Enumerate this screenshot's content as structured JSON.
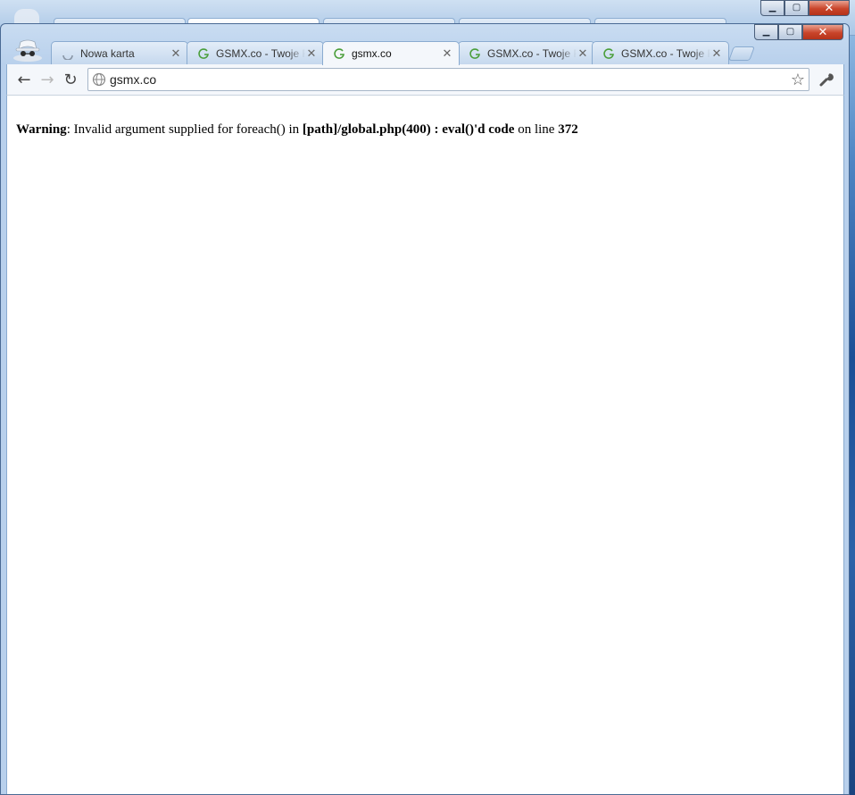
{
  "window": {
    "minimize_glyph": "▁",
    "maximize_glyph": "▢",
    "close_glyph": "✕"
  },
  "tabs": [
    {
      "title": "Nowa karta",
      "icon": "loading-spinner-icon",
      "active": false,
      "close": "✕"
    },
    {
      "title": "GSMX.co - Twoje Forum",
      "icon": "gsmx-favicon-icon",
      "active": false,
      "close": "✕"
    },
    {
      "title": "gsmx.co",
      "icon": "gsmx-favicon-icon",
      "active": true,
      "close": "✕"
    },
    {
      "title": "GSMX.co - Twoje Forum",
      "icon": "gsmx-favicon-icon",
      "active": false,
      "close": "✕"
    },
    {
      "title": "GSMX.co - Twoje Forum",
      "icon": "gsmx-favicon-icon",
      "active": false,
      "close": "✕"
    }
  ],
  "toolbar": {
    "back_glyph": "←",
    "forward_glyph": "→",
    "reload_glyph": "↻",
    "url": "gsmx.co",
    "star_glyph": "☆"
  },
  "page": {
    "warning_label": "Warning",
    "warning_text_1": ": Invalid argument supplied for foreach() in ",
    "warning_path": "[path]/global.php(400) : eval()'d code",
    "warning_text_2": " on line ",
    "warning_line": "372"
  },
  "colors": {
    "favicon_green": "#4a9e3a",
    "close_red": "#c9442a",
    "frame_blue": "#b8d0ec"
  }
}
